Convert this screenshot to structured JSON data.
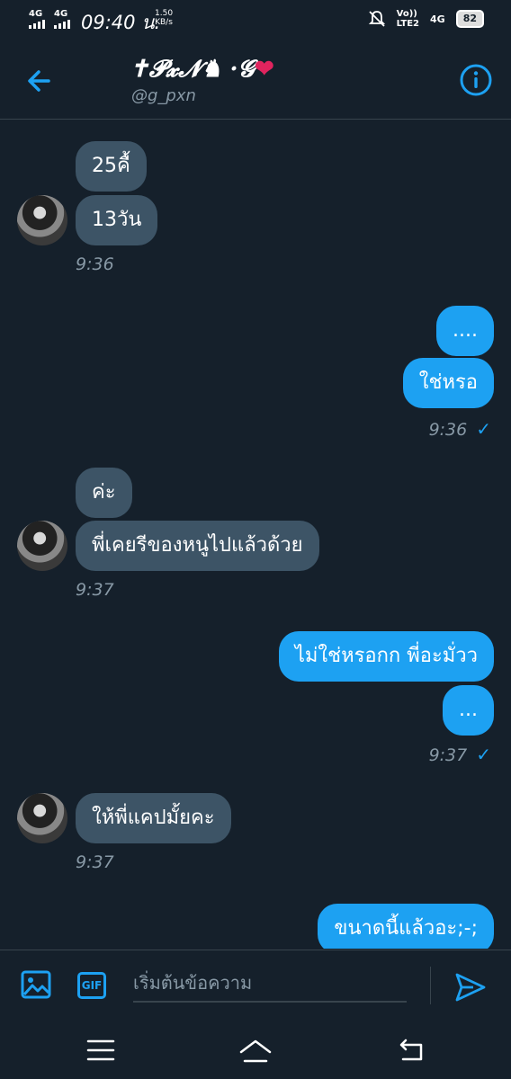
{
  "status": {
    "sig1": "4G",
    "sig2": "4G",
    "time": "09:40 น.",
    "speed_value": "1.50",
    "speed_unit": "KB/s",
    "volte": "Vo))\nLTE2",
    "net_right": "4G",
    "battery": "82"
  },
  "header": {
    "name": "✝𝓟𝔁𝓝♞ ·𝓖",
    "heart": "❤",
    "handle": "@g_pxn"
  },
  "messages": [
    {
      "text": "25คื้"
    },
    {
      "text": "13วัน"
    },
    {
      "time": "9:36"
    },
    {
      "text": "...."
    },
    {
      "text": "ใช่หรอ"
    },
    {
      "time": "9:36"
    },
    {
      "text": "ค่ะ"
    },
    {
      "text": "พี่เคยรีของหนูไปแล้วด้วย"
    },
    {
      "time": "9:37"
    },
    {
      "text": "ไม่ใช่หรอกก พี่อะมั่วว"
    },
    {
      "text": "..."
    },
    {
      "time": "9:37"
    },
    {
      "text": "ให้พี่แคปมั้ยคะ"
    },
    {
      "time": "9:37"
    },
    {
      "text": "ขนาดนี้แล้วอะ;-;"
    }
  ],
  "composer": {
    "gif_label": "GIF",
    "placeholder": "เริ่มต้นข้อความ"
  },
  "colors": {
    "background": "#15202b",
    "incoming": "#3d5466",
    "outgoing": "#1da1f2",
    "muted": "#8899a6"
  }
}
